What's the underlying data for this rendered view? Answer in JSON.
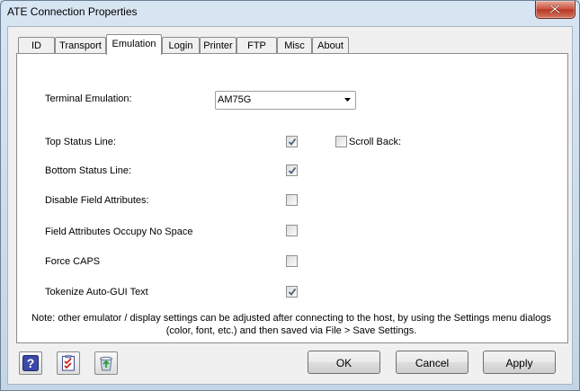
{
  "window": {
    "title": "ATE Connection Properties"
  },
  "tabs": [
    {
      "label": "ID",
      "active": false
    },
    {
      "label": "Transport",
      "active": false
    },
    {
      "label": "Emulation",
      "active": true
    },
    {
      "label": "Login",
      "active": false
    },
    {
      "label": "Printer",
      "active": false
    },
    {
      "label": "FTP",
      "active": false
    },
    {
      "label": "Misc",
      "active": false
    },
    {
      "label": "About",
      "active": false
    }
  ],
  "emulation": {
    "terminal_emulation_label": "Terminal Emulation:",
    "terminal_emulation_value": "AM75G",
    "options": [
      {
        "label": "Top Status Line:",
        "checked": true
      },
      {
        "label": "Bottom Status Line:",
        "checked": true
      },
      {
        "label": "Disable Field Attributes:",
        "checked": false
      },
      {
        "label": "Field Attributes Occupy No Space",
        "checked": false
      },
      {
        "label": "Force CAPS",
        "checked": false
      },
      {
        "label": "Tokenize Auto-GUI Text",
        "checked": true
      }
    ],
    "scroll_back": {
      "label": "Scroll Back:",
      "checked": false
    },
    "note_line1": "Note: other emulator / display settings can be adjusted after connecting to the host, by using the Settings menu dialogs",
    "note_line2": "(color, font, etc.) and then saved via File > Save Settings."
  },
  "buttons": {
    "ok": "OK",
    "cancel": "Cancel",
    "apply": "Apply"
  },
  "icons": {
    "help": "help-icon",
    "checklist": "checklist-icon",
    "recycle": "recycle-bin-icon",
    "close": "close-icon",
    "dropdown": "chevron-down-icon"
  },
  "colors": {
    "close_button": "#c7503b",
    "help_icon": "#3b4aa8",
    "check_mark": "#4a5f7a"
  }
}
